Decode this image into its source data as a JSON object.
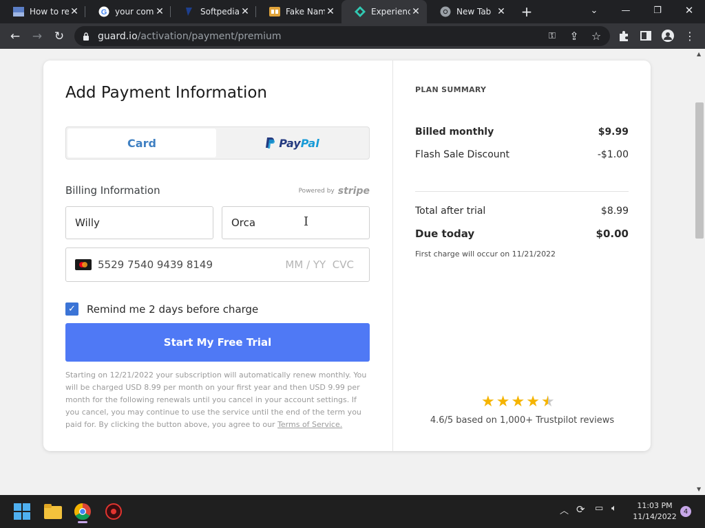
{
  "browser": {
    "tabs": [
      {
        "title": "How to rem",
        "icon": "document-icon"
      },
      {
        "title": "your compu",
        "icon": "google-icon"
      },
      {
        "title": "Softpedia -",
        "icon": "softpedia-icon"
      },
      {
        "title": "Fake Name",
        "icon": "fakename-icon"
      },
      {
        "title": "Experience",
        "icon": "guard-icon"
      },
      {
        "title": "New Tab",
        "icon": "chrome-icon"
      }
    ],
    "url_host": "guard.io",
    "url_path": "/activation/payment/premium"
  },
  "payment": {
    "title": "Add Payment Information",
    "tab_card": "Card",
    "tab_paypal_1": "Pay",
    "tab_paypal_2": "Pal",
    "billing_label": "Billing Information",
    "powered_by": "Powered by",
    "stripe": "stripe",
    "first_name": "Willy",
    "last_name": "Orca",
    "card_number": "5529 7540 9439 8149",
    "expiry_placeholder": "MM / YY",
    "cvc_placeholder": "CVC",
    "remind_label": "Remind me 2 days before charge",
    "remind_checked": true,
    "cta": "Start My Free Trial",
    "legal": "Starting on 12/21/2022 your subscription will automatically renew monthly. You will be charged USD 8.99 per month on your first year and then USD 9.99 per month for the following renewals until you cancel in your account settings. If you cancel, you may continue to use the service until the end of the term you paid for. By clicking the button above, you agree to our ",
    "terms": "Terms of Service.",
    "brand_colors": {
      "accent": "#4f79f5",
      "card_tab": "#3f80c2"
    }
  },
  "summary": {
    "heading": "PLAN SUMMARY",
    "billed_label": "Billed monthly",
    "billed_value": "$9.99",
    "discount_label": "Flash Sale Discount",
    "discount_value": "-$1.00",
    "total_label": "Total after trial",
    "total_value": "$8.99",
    "due_label": "Due today",
    "due_value": "$0.00",
    "first_charge": "First charge will occur on 11/21/2022",
    "rating_stars": 4.6,
    "rating_text": "4.6/5 based on 1,000+ Trustpilot reviews"
  },
  "taskbar": {
    "time": "11:03 PM",
    "date": "11/14/2022",
    "notifications": "4"
  }
}
